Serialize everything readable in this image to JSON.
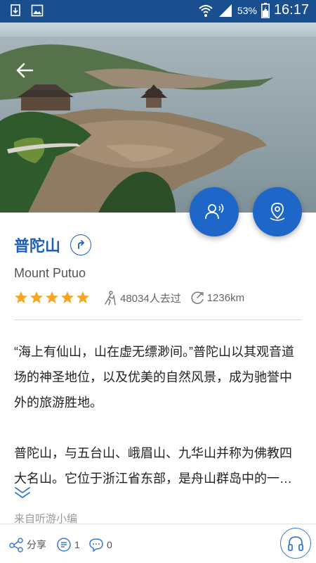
{
  "status_bar": {
    "battery_percent": "53%",
    "time": "16:17",
    "icons": [
      "download-notification-icon",
      "image-notification-icon",
      "wifi-icon",
      "signal-icon",
      "battery-icon"
    ]
  },
  "hero": {
    "image_icon": "coastal-landscape-photo",
    "back_icon": "back-arrow-icon"
  },
  "actions": {
    "audio_guide_icon": "audio-guide-icon",
    "map_icon": "map-pin-icon"
  },
  "place": {
    "name": "普陀山",
    "english_name": "Mount Putuo",
    "rating": 5,
    "rating_max": 5,
    "visitors": "48034人去过",
    "distance": "1236km"
  },
  "description": {
    "paragraph1": "“海上有仙山，山在虚无缥渺间。”普陀山以其观音道场的神圣地位，以及优美的自然风景，成为驰誉中外的旅游胜地。",
    "paragraph2": "普陀山，与五台山、峨眉山、九华山并称为佛教四大名山。它位于浙江省东部，是舟山群岛中的一个岛屿，风景秀丽。",
    "source": "来自听游小编"
  },
  "bottom_bar": {
    "share_label": "分享",
    "comment_count": "1",
    "like_count": "0"
  },
  "colors": {
    "status_bar": "#1a4f8f",
    "accent": "#1f66c9",
    "title": "#1f5fb8",
    "star": "#f5a623"
  }
}
